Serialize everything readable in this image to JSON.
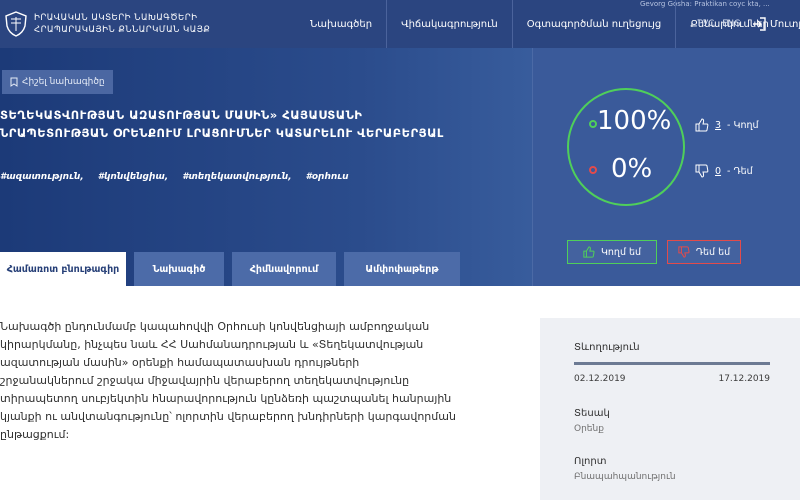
{
  "header": {
    "logo_line1": "ԻՐԱՎԱԿԱՆ ԱԿՏԵՐԻ ՆԱԽԱԳԾԵՐԻ",
    "logo_line2": "ՀՐԱՊԱՐԱԿԱՅԻՆ ՔՆՆԱՐԿՄԱՆ ԿԱՅՔ",
    "user_text": "Gevorg Gosha: Praktikan соус kta, ...",
    "nav": [
      "Նախագծեր",
      "Վիճակագրություն",
      "Օգտագործման ուղեցույց",
      "Քննարկումներ"
    ],
    "lang_ru": "РУС",
    "lang_en": "ENG",
    "login_label": "Մուտք"
  },
  "hero": {
    "back_label": "Հիշել նախագիծը",
    "title_line1": "ՏԵՂԵԿԱՏՎՈՒԹՅԱՆ ԱԶԱՏՈՒԹՅԱՆ ՄԱՍԻՆ» ՀԱՅԱՍՏԱՆԻ",
    "title_line2": "ՆՐԱՊԵՏՈՒԹՅԱՆ ՕՐԵՆՔՈՒՄ ԼՐԱՑՈՒՄՆԵՐ ԿԱՏԱՐԵԼՈՒ ՎԵՐԱԲԵՐՅԱԼ",
    "tags": [
      "#ազատություն,",
      "#կոնվենցիա,",
      "#տեղեկատվություն,",
      "#օրհուս"
    ]
  },
  "vote": {
    "yes_percent": "100%",
    "no_percent": "0%",
    "yes_count": "3",
    "yes_count_label": "- Կողմ",
    "no_count": "0",
    "no_count_label": "- Դեմ",
    "yes_button": "Կողմ եմ",
    "no_button": "Դեմ եմ",
    "yes_fraction": 1.0
  },
  "tabs": [
    "Համառոտ բնութագիր",
    "Նախագիծ",
    "Հիմնավորում",
    "Ամփոփաթերթ"
  ],
  "description": [
    "Նախագծի ընդունմամբ կապահովվի Օրհուսի կոնվենցիայի ամբողջական",
    "կիրարկմանը, ինչպես նաև ՀՀ Սահմանադրության և «Տեղեկատվության",
    "ազատության մասին» օրենքի համապատասխան դրույթների",
    "շրջանակներում շրջակա միջավայրին վերաբերող տեղեկատվությունը",
    "տիրապետող սուբյեկտին հնարավորություն կընձեռի  պաշտպանել հանրային",
    "կյանքի ու անվտանգությունը՝ ոլորտին վերաբերող խնդիրների կարգավորման",
    "ընթացքում:"
  ],
  "sidebar": {
    "duration_label": "Տևողություն",
    "start_date": "02.12.2019",
    "end_date": "17.12.2019",
    "progress_fraction": 1.0,
    "type_label": "Տեսակ",
    "type_value": "Օրենք",
    "area_label": "Ոլորտ",
    "area_value": "Բնապահպանություն"
  },
  "colors": {
    "header_bg": "#2b4580",
    "accent_green": "#4fcf5a",
    "accent_red": "#e24b4b"
  }
}
